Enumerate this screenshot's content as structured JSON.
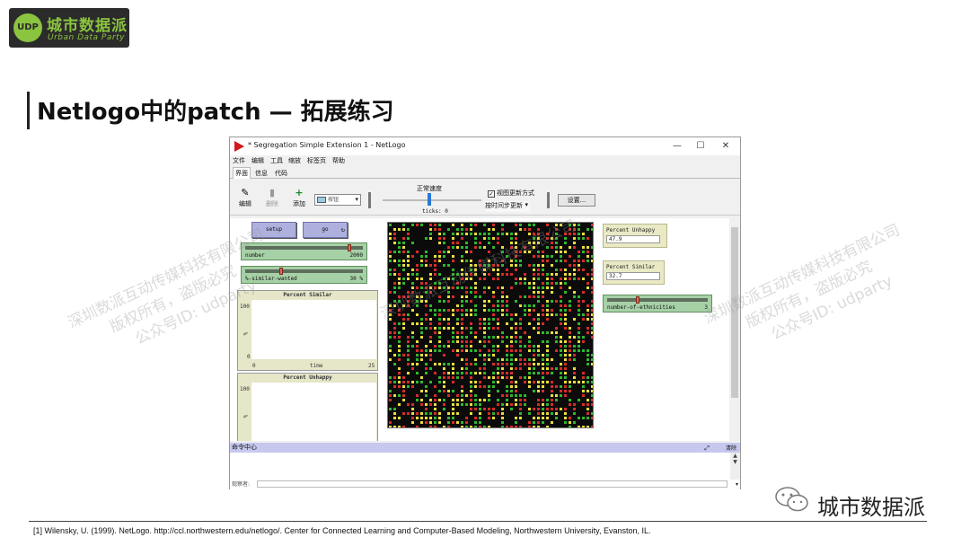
{
  "logo": {
    "cn": "城市数据派",
    "en": "Urban Data Party",
    "badge": "UDP"
  },
  "slide_title": "Netlogo中的patch — 拓展练习",
  "watermark": {
    "line1": "深圳数派互动传媒科技有限公司",
    "line2": "版权所有，盗版必究",
    "line3": "公众号ID: udparty"
  },
  "window": {
    "title": "* Segregation Simple Extension 1 - NetLogo",
    "controls": {
      "minimize": "—",
      "maximize": "☐",
      "close": "✕"
    },
    "menu": [
      "文件",
      "编辑",
      "工具",
      "缩放",
      "标签页",
      "帮助"
    ],
    "tabs": [
      "界面",
      "信息",
      "代码"
    ],
    "toolbar": {
      "edit": "编辑",
      "delete": "删除",
      "add": "添加",
      "widget_type": "按钮",
      "speed_label": "正常速度",
      "ticks_label": "ticks: 0",
      "view_updates": "视图更新方式",
      "update_mode": "按时间步更新",
      "settings": "设置..."
    },
    "interface": {
      "buttons": {
        "setup": "setup",
        "go": "go"
      },
      "sliders": [
        {
          "name": "number",
          "value": "2000",
          "fraction": 0.9
        },
        {
          "name": "%-similar-wanted",
          "value": "30 %",
          "fraction": 0.3
        },
        {
          "name": "number-of-ethnicities",
          "value": "3",
          "fraction": 0.3
        }
      ],
      "plots": [
        {
          "title": "Percent Similar",
          "ymax": "100",
          "ymin": "0",
          "xmin": "0",
          "xmax": "25",
          "xlabel": "time",
          "ylabel": "%"
        },
        {
          "title": "Percent Unhappy",
          "ymax": "100",
          "ylabel": "%"
        }
      ],
      "monitors": [
        {
          "label": "Percent Unhappy",
          "value": "47.9"
        },
        {
          "label": "Percent Similar",
          "value": "32.7"
        }
      ],
      "world_colors": [
        "#d62b2b",
        "#2fb62f",
        "#e8dd3e"
      ]
    },
    "command_center": {
      "title": "命令中心",
      "clear": "清除",
      "observer": "观察者:"
    }
  },
  "brand": "城市数据派",
  "citation": "[1] Wilensky, U. (1999). NetLogo.  http://ccl.northwestern.edu/netlogo/.  Center for Connected Learning and Computer-Based Modeling, Northwestern University, Evanston, IL."
}
